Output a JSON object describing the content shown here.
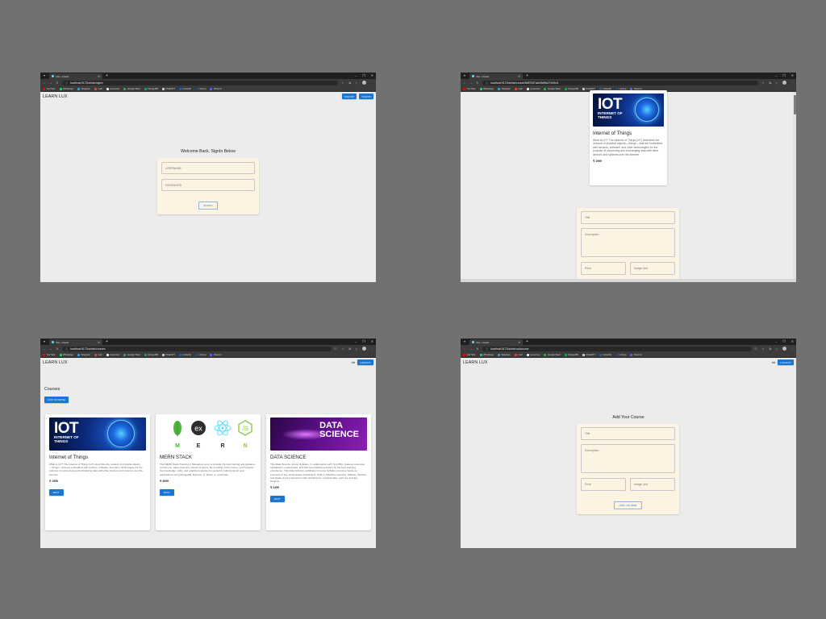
{
  "browser": {
    "tab_title": "Vite + React",
    "urls": {
      "signin": "localhost:5173/admin/signin",
      "edit": "localhost:5173/admin/course/6687057adc9fe89d27e52cf1",
      "courses": "localhost:5173/admin/courses",
      "add": "localhost:5173/admin/addcourse"
    },
    "bookmarks": [
      {
        "label": "YouTube",
        "color": "#ff0000"
      },
      {
        "label": "WhatsApp",
        "color": "#25d366"
      },
      {
        "label": "Telegram",
        "color": "#2aa3e0"
      },
      {
        "label": "mail",
        "color": "#ea4335"
      },
      {
        "label": "resources",
        "color": "#eeeeee"
      },
      {
        "label": "Google Meet",
        "color": "#34a853"
      },
      {
        "label": "MongoDB",
        "color": "#13aa52"
      },
      {
        "label": "ChatGPT",
        "color": "#cccccc"
      },
      {
        "label": "LinkedIn",
        "color": "#0a66c2"
      },
      {
        "label": "Unstop",
        "color": "#1c4980"
      },
      {
        "label": "Discord",
        "color": "#5865f2"
      }
    ]
  },
  "app": {
    "brand": "LEARN LUX",
    "signup_label": "SIGNUP",
    "signin_label": "SIGNIN",
    "logout_label": "LOGOUT",
    "username": "rkt"
  },
  "signin": {
    "heading": "Welcome Back, SignIn Below",
    "username_placeholder": "USERNAME",
    "password_placeholder": "PASSWORD",
    "submit_label": "SIGNIN"
  },
  "courses_page": {
    "heading": "Courses",
    "add_button": "ADD COURSE",
    "edit_label": "EDIT",
    "courses": [
      {
        "title": "Internet of Things",
        "description": "What is IoT? The Internet of Things (IoT) describes the network of physical objects—'things'—that are embedded with sensors, software, and other technologies for the purpose of connecting and exchanging data with other devices and systems over the internet.",
        "price": "₹ 1999",
        "image": {
          "big": "IOT",
          "small1": "INTERNET OF",
          "small2": "THINGS"
        }
      },
      {
        "title": "MERN STACK",
        "description": "The MERN Stack Training in Mangalore aims to provide the best training and guidance to help you make maximum career progress. By enrolling in the course, you'll acquire the knowledge, skills, and practical experience needed to build dynamic web applications using MongoDB, Express. js, React. js, and Node.",
        "price": "₹ 4999",
        "image": {
          "letters": [
            "M",
            "E",
            "R",
            "N"
          ],
          "ex": "ex",
          "js": "JS"
        }
      },
      {
        "title": "DATA SCIENCE",
        "description": "This Data Science course Syllabus, in collaboration with Top MNC, features extensive hackathons, masterclass, and Ask-me-anything sessions for the best learning experience. This Data Science certification Course Syllabus provides hands-on exposure to key technologies including R, Python, Machine Learning, Tableau, Hadoop, and Spark via live interaction with practitioners, practical labs, and Live Industry Projects.",
        "price": "₹ 2499",
        "image": {
          "line1": "DATA",
          "line2": "SCIENCE"
        }
      }
    ]
  },
  "course_form": {
    "heading": "Add Your Course",
    "title_placeholder": "Title",
    "description_placeholder": "Description",
    "price_placeholder": "Price",
    "image_placeholder": "Image Link",
    "submit_label": "ADD COURSE"
  }
}
